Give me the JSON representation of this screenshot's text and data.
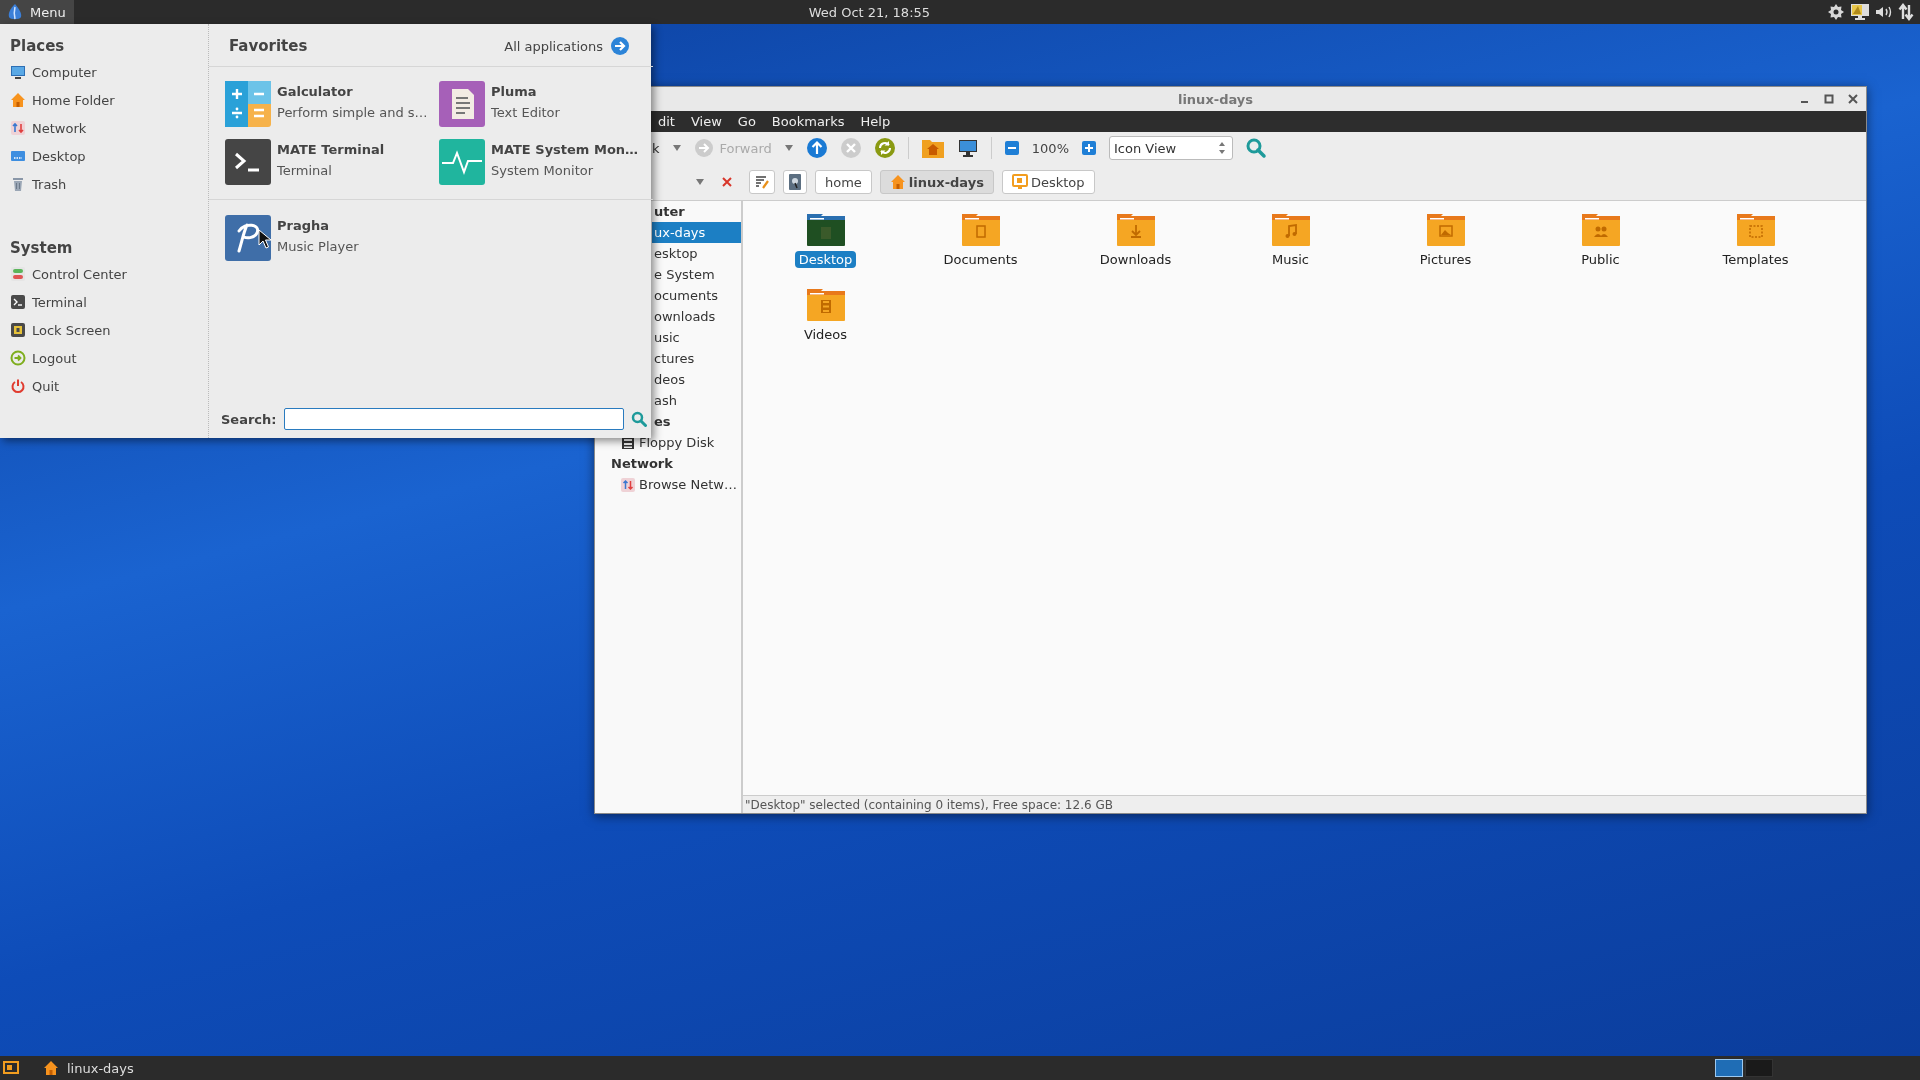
{
  "top_panel": {
    "menu_label": "Menu",
    "clock": "Wed Oct 21, 18:55"
  },
  "menu": {
    "places_title": "Places",
    "places": [
      "Computer",
      "Home Folder",
      "Network",
      "Desktop",
      "Trash"
    ],
    "system_title": "System",
    "system": [
      "Control Center",
      "Terminal",
      "Lock Screen",
      "Logout",
      "Quit"
    ],
    "favorites_title": "Favorites",
    "all_applications": "All applications",
    "favorite_groups": [
      [
        {
          "name": "Galculator",
          "description": "Perform simple and s…"
        },
        {
          "name": "Pluma",
          "description": "Text Editor"
        },
        {
          "name": "MATE Terminal",
          "description": "Terminal"
        },
        {
          "name": "MATE System Mon…",
          "description": "System Monitor"
        }
      ],
      [
        {
          "name": "Pragha",
          "description": "Music Player"
        }
      ]
    ],
    "search_label": "Search:"
  },
  "file_manager": {
    "title": "linux-days",
    "menubar": [
      "dit",
      "View",
      "Go",
      "Bookmarks",
      "Help"
    ],
    "toolbar": {
      "back": {
        "label": "k",
        "disabled": false
      },
      "forward": {
        "label": "Forward",
        "disabled": true
      },
      "stop": {
        "disabled": true
      },
      "zoom": "100%",
      "view_mode": "Icon View"
    },
    "path": [
      {
        "label": "home",
        "selected": false
      },
      {
        "label": "linux-days",
        "selected": true
      },
      {
        "label": "Desktop",
        "selected": false
      }
    ],
    "sidebar": [
      {
        "kind": "header",
        "label": "uter",
        "cut": true,
        "selected": false
      },
      {
        "kind": "place",
        "label": "ux-days",
        "cut": true,
        "selected": true
      },
      {
        "kind": "place",
        "label": "esktop",
        "cut": true,
        "selected": false
      },
      {
        "kind": "place",
        "label": "e System",
        "cut": true,
        "selected": false
      },
      {
        "kind": "place",
        "label": "ocuments",
        "cut": true,
        "selected": false
      },
      {
        "kind": "place",
        "label": "ownloads",
        "cut": true,
        "selected": false
      },
      {
        "kind": "place",
        "label": "usic",
        "cut": true,
        "selected": false
      },
      {
        "kind": "place",
        "label": "ctures",
        "cut": true,
        "selected": false
      },
      {
        "kind": "place",
        "label": "deos",
        "cut": true,
        "selected": false
      },
      {
        "kind": "place",
        "label": "ash",
        "cut": true,
        "selected": false
      },
      {
        "kind": "header",
        "label": "es",
        "cut": true,
        "selected": false
      },
      {
        "kind": "place",
        "label": "Floppy Disk",
        "cut": false,
        "selected": false
      },
      {
        "kind": "header",
        "label": "Network",
        "cut": false,
        "selected": false
      },
      {
        "kind": "place",
        "label": "Browse Netw…",
        "cut": false,
        "selected": false
      }
    ],
    "folders": [
      {
        "label": "Desktop",
        "selected": true
      },
      {
        "label": "Documents",
        "selected": false
      },
      {
        "label": "Downloads",
        "selected": false
      },
      {
        "label": "Music",
        "selected": false
      },
      {
        "label": "Pictures",
        "selected": false
      },
      {
        "label": "Public",
        "selected": false
      },
      {
        "label": "Templates",
        "selected": false
      },
      {
        "label": "Videos",
        "selected": false
      }
    ],
    "status": "\"Desktop\" selected (containing 0 items), Free space: 12.6 GB"
  },
  "bottom_panel": {
    "tasks": [
      {
        "label": "linux-days"
      }
    ],
    "workspaces": [
      {
        "selected": true
      },
      {
        "selected": false
      }
    ]
  }
}
